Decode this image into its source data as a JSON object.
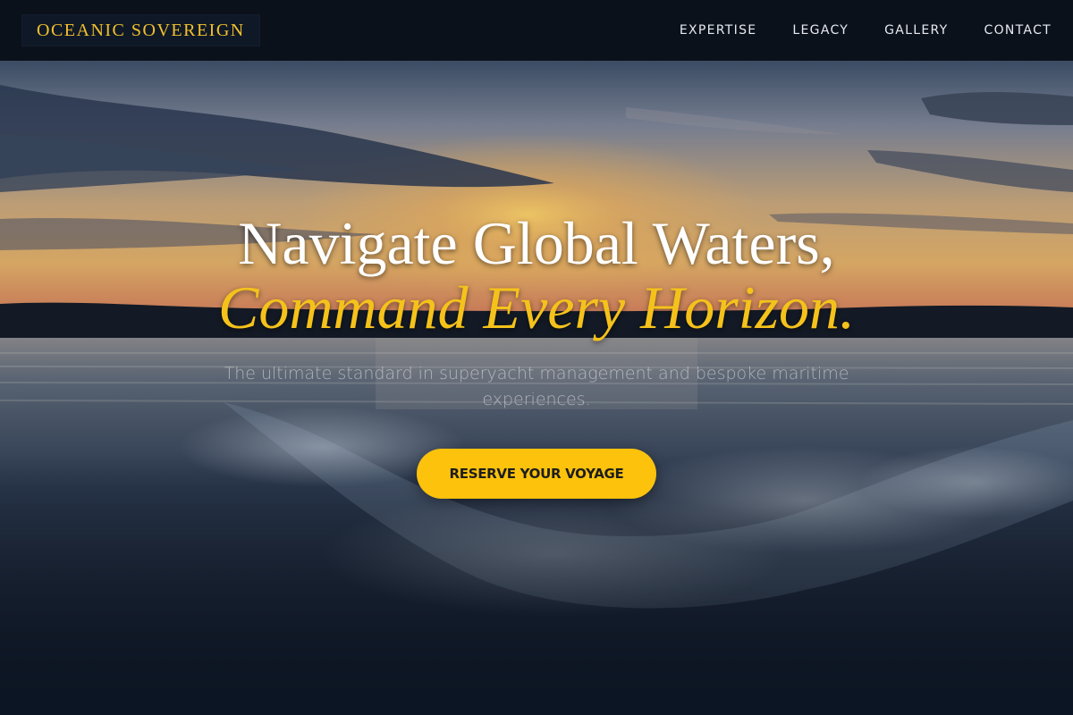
{
  "brand": {
    "name": "OCEANIC SOVEREIGN"
  },
  "nav": {
    "items": [
      {
        "label": "EXPERTISE"
      },
      {
        "label": "LEGACY"
      },
      {
        "label": "GALLERY"
      },
      {
        "label": "CONTACT"
      }
    ]
  },
  "hero": {
    "headline_line1": "Navigate Global Waters,",
    "headline_line2": "Command Every Horizon.",
    "subtitle": "The ultimate standard in superyacht management and bespoke maritime experiences.",
    "cta_label": "RESERVE YOUR VOYAGE",
    "background_image": "sunset-ocean-wake-photo"
  },
  "colors": {
    "accent": "#f5c21b",
    "button": "#fcc20c",
    "navbar": "#0b111b",
    "nav_text": "#e6e9ee"
  }
}
